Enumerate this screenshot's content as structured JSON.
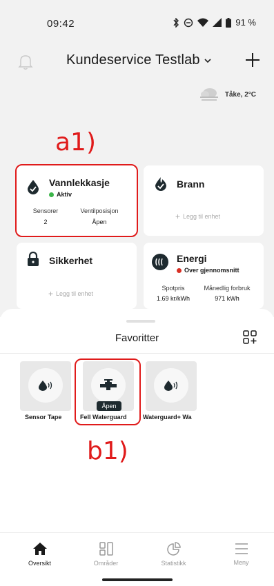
{
  "status_bar": {
    "time": "09:42",
    "battery": "91 %"
  },
  "header": {
    "title": "Kundeservice Testlab",
    "title_chevron": "chevron-down-icon",
    "bell_icon": "bell-icon",
    "add_icon": "plus-icon"
  },
  "weather": {
    "text": "Tåke, 2°C",
    "icon": "fog-cloud-icon"
  },
  "annotations": {
    "a1": "a1)",
    "b1": "b1)",
    "color": "#e01b1b"
  },
  "cards": {
    "vannlekkasje": {
      "title": "Vannlekkasje",
      "status": "Aktiv",
      "status_color": "#3cb54a",
      "sensors_label": "Sensorer",
      "sensors_value": "2",
      "valve_label": "Ventilposisjon",
      "valve_value": "Åpen",
      "icon": "water-drop-check-icon"
    },
    "brann": {
      "title": "Brann",
      "add_unit": "Legg til enhet",
      "icon": "fire-check-icon"
    },
    "sikkerhet": {
      "title": "Sikkerhet",
      "add_unit": "Legg til enhet",
      "icon": "lock-icon"
    },
    "energi": {
      "title": "Energi",
      "status": "Over gjennomsnitt",
      "status_color": "#d93025",
      "spot_label": "Spotpris",
      "spot_value": "1.69 kr/kWh",
      "monthly_label": "Månedlig forbruk",
      "monthly_value": "971 kWh",
      "icon": "energy-waves-icon"
    }
  },
  "favorites": {
    "title": "Favoritter",
    "edit_icon": "add-widget-icon",
    "items": [
      {
        "label": "Sensor Tape",
        "icon": "water-sensor-icon"
      },
      {
        "label": "Fell Waterguard",
        "icon": "valve-icon",
        "badge": "Åpen"
      },
      {
        "label": "Waterguard+ Wa",
        "icon": "water-sensor-icon"
      }
    ]
  },
  "nav": [
    {
      "label": "Oversikt",
      "icon": "home-icon",
      "active": true
    },
    {
      "label": "Områder",
      "icon": "grid-icon",
      "active": false
    },
    {
      "label": "Statistikk",
      "icon": "pie-chart-icon",
      "active": false
    },
    {
      "label": "Meny",
      "icon": "menu-icon",
      "active": false
    }
  ]
}
